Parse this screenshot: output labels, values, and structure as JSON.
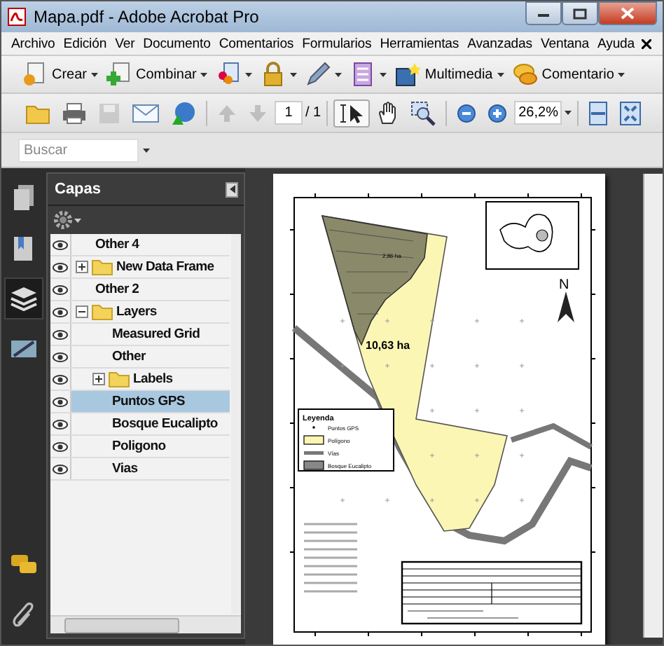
{
  "window": {
    "title": "Mapa.pdf - Adobe Acrobat Pro"
  },
  "menu": [
    "Archivo",
    "Edición",
    "Ver",
    "Documento",
    "Comentarios",
    "Formularios",
    "Herramientas",
    "Avanzadas",
    "Ventana",
    "Ayuda"
  ],
  "toolbar": [
    {
      "kind": "create",
      "label": "Crear"
    },
    {
      "kind": "combine",
      "label": "Combinar"
    },
    {
      "kind": "collaborate"
    },
    {
      "kind": "secure"
    },
    {
      "kind": "sign"
    },
    {
      "kind": "forms"
    },
    {
      "kind": "multimedia",
      "label": "Multimedia"
    },
    {
      "kind": "comment",
      "label": "Comentario"
    }
  ],
  "nav_toolbar": {
    "page": "1",
    "page_count": "/ 1",
    "zoom": "26,2%",
    "tools": [
      {
        "kind": "select",
        "selected": true
      },
      {
        "kind": "hand",
        "selected": false
      },
      {
        "kind": "zoom",
        "selected": false
      }
    ]
  },
  "search": {
    "placeholder": "Buscar"
  },
  "side_tabs": [
    {
      "kind": "pages",
      "selected": false
    },
    {
      "kind": "bookmarks",
      "selected": false
    },
    {
      "kind": "layers",
      "selected": true
    },
    {
      "kind": "signatures",
      "selected": false
    }
  ],
  "layers_panel": {
    "title": "Capas",
    "items": [
      {
        "label": "Other 4",
        "kind": "layer",
        "selected": false
      },
      {
        "label": "New Data Frame",
        "kind": "folder",
        "expanded": false,
        "selected": false
      },
      {
        "label": "Other 2",
        "kind": "layer",
        "selected": false
      },
      {
        "label": "Layers",
        "kind": "folder",
        "expanded": true,
        "selected": false,
        "children": [
          {
            "label": "Measured Grid",
            "kind": "layer",
            "selected": false
          },
          {
            "label": "Other",
            "kind": "layer",
            "selected": false
          },
          {
            "label": "Labels",
            "kind": "folder",
            "expanded": false,
            "selected": false
          },
          {
            "label": "Puntos GPS",
            "kind": "layer",
            "selected": true
          },
          {
            "label": "Bosque Eucalipto",
            "kind": "layer",
            "selected": false
          },
          {
            "label": "Poligono",
            "kind": "layer",
            "selected": false
          },
          {
            "label": "Vias",
            "kind": "layer",
            "selected": false
          }
        ]
      }
    ]
  },
  "document": {
    "map": {
      "areas": [
        "2,86 ha",
        "10,63 ha"
      ],
      "north": "N",
      "legend": {
        "title": "Leyenda",
        "items": [
          {
            "kind": "point",
            "label": "Puntos GPS"
          },
          {
            "kind": "polygon",
            "label": "Polígono"
          },
          {
            "kind": "road",
            "label": "Vías"
          },
          {
            "kind": "forest",
            "label": "Bosque Eucalipto"
          }
        ]
      }
    }
  }
}
